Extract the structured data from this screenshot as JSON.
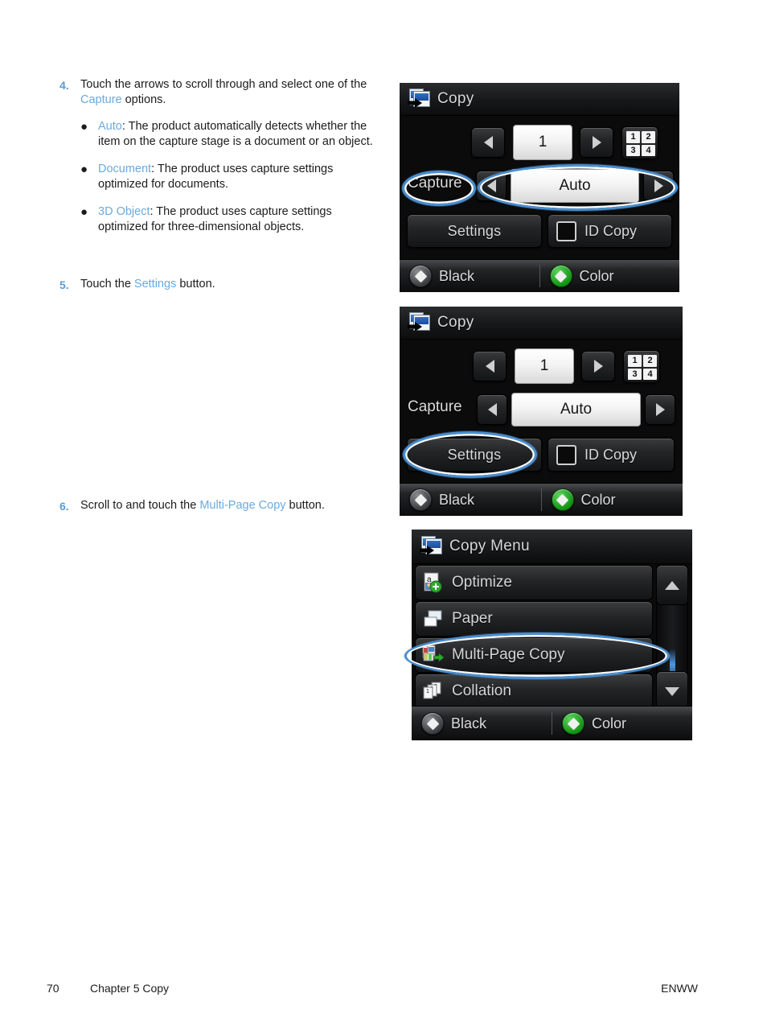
{
  "page": {
    "number": "70",
    "chapter": "Chapter 5   Copy",
    "locale": "ENWW"
  },
  "steps": [
    {
      "num": "4.",
      "text_before": "Touch the arrows to scroll through and select one of the ",
      "link": "Capture",
      "text_after": " options.",
      "bullets": [
        {
          "marker": "●",
          "link": "Auto",
          "text": ": The product automatically detects whether the item on the capture stage is a document or an object."
        },
        {
          "marker": "●",
          "link": "Document",
          "text": ": The product uses capture settings optimized for documents."
        },
        {
          "marker": "●",
          "link": "3D Object",
          "text": ": The product uses capture settings optimized for three-dimensional objects."
        }
      ]
    },
    {
      "num": "5.",
      "text_before": "Touch the ",
      "link": "Settings",
      "text_after": " button."
    },
    {
      "num": "6.",
      "text_before": "Scroll to and touch the ",
      "link": "Multi-Page Copy",
      "text_after": " button."
    }
  ],
  "screens": {
    "copy_1": {
      "title": "Copy",
      "title_icon": "copy-icon",
      "copies_value": "1",
      "left_arrow_icon": "arrow-left-icon",
      "right_arrow_icon": "arrow-right-icon",
      "collate_icon_cells": [
        "1",
        "2",
        "3",
        "4"
      ],
      "capture_label": "Capture",
      "capture_value": "Auto",
      "settings_label": "Settings",
      "id_copy_label": "ID Copy",
      "id_copy_icon": "id-card-icon",
      "black_label": "Black",
      "color_label": "Color",
      "highlights": [
        "capture-label",
        "capture-selector"
      ]
    },
    "copy_2": {
      "title": "Copy",
      "title_icon": "copy-icon",
      "copies_value": "1",
      "left_arrow_icon": "arrow-left-icon",
      "right_arrow_icon": "arrow-right-icon",
      "collate_icon_cells": [
        "1",
        "2",
        "3",
        "4"
      ],
      "capture_label": "Capture",
      "capture_value": "Auto",
      "settings_label": "Settings",
      "id_copy_label": "ID Copy",
      "id_copy_icon": "id-card-icon",
      "black_label": "Black",
      "color_label": "Color",
      "highlights": [
        "settings-button"
      ]
    },
    "copy_menu": {
      "title": "Copy Menu",
      "title_icon": "copy-icon",
      "items": [
        {
          "label": "Optimize",
          "icon": "optimize-icon"
        },
        {
          "label": "Paper",
          "icon": "paper-icon"
        },
        {
          "label": "Multi-Page Copy",
          "icon": "multi-page-copy-icon"
        },
        {
          "label": "Collation",
          "icon": "collation-icon"
        }
      ],
      "scroll_up_icon": "scroll-up-arrow-icon",
      "scroll_down_icon": "scroll-down-arrow-icon",
      "black_label": "Black",
      "color_label": "Color",
      "highlights": [
        "menu-item-multi-page-copy"
      ]
    }
  },
  "colors": {
    "link_blue": "#6aaadd",
    "step_number_blue": "#5a9bd5",
    "highlight_blue": "#4a8fd0",
    "start_color_green": "#1aa01a"
  }
}
